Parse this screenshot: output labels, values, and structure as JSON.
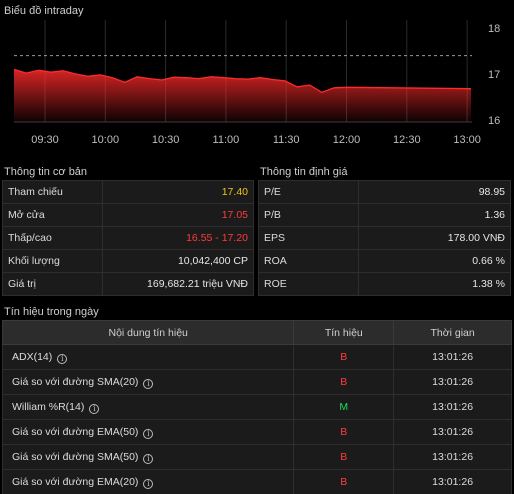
{
  "chart": {
    "title": "Biểu đồ intraday",
    "y_ticks": [
      "18",
      "17",
      "16"
    ],
    "x_ticks": [
      "09:30",
      "10:00",
      "10:30",
      "11:00",
      "11:30",
      "12:00",
      "12:30",
      "13:00"
    ]
  },
  "chart_data": {
    "type": "area",
    "x": [
      "09:15",
      "09:20",
      "09:25",
      "09:30",
      "09:35",
      "09:40",
      "09:45",
      "09:50",
      "09:55",
      "10:00",
      "10:05",
      "10:10",
      "10:15",
      "10:20",
      "10:25",
      "10:30",
      "10:35",
      "10:40",
      "10:45",
      "10:50",
      "10:55",
      "11:00",
      "11:05",
      "11:10",
      "11:15",
      "11:20",
      "11:25",
      "11:30",
      "13:00"
    ],
    "values": [
      17.1,
      17.02,
      17.08,
      17.04,
      17.07,
      17.0,
      16.95,
      16.98,
      16.92,
      16.82,
      16.94,
      16.9,
      16.87,
      16.93,
      16.92,
      16.9,
      16.94,
      16.92,
      16.9,
      16.89,
      16.92,
      16.88,
      16.85,
      16.72,
      16.76,
      16.6,
      16.7,
      16.71,
      16.68
    ],
    "reference": 17.4,
    "ylim": [
      16.0,
      18.0
    ],
    "colors": {
      "line": "#ff2a2a",
      "reference": "#9a9a9a"
    }
  },
  "basic_info": {
    "title": "Thông tin cơ bản",
    "rows": [
      {
        "label": "Tham chiếu",
        "value": "17.40"
      },
      {
        "label": "Mở cửa",
        "value": "17.05"
      },
      {
        "label": "Thấp/cao",
        "low": "16.55",
        "sep": " - ",
        "high": "17.20"
      },
      {
        "label": "Khối lượng",
        "value": "10,042,400 CP"
      },
      {
        "label": "Giá trị",
        "value": "169,682.21 triệu VNĐ"
      }
    ]
  },
  "valuation": {
    "title": "Thông tin định giá",
    "rows": [
      {
        "label": "P/E",
        "value": "98.95"
      },
      {
        "label": "P/B",
        "value": "1.36"
      },
      {
        "label": "EPS",
        "value": "178.00 VNĐ"
      },
      {
        "label": "ROA",
        "value": "0.66 %"
      },
      {
        "label": "ROE",
        "value": "1.38 %"
      }
    ]
  },
  "signals": {
    "title": "Tín hiệu trong ngày",
    "headers": [
      "Nội dung tín hiệu",
      "Tín hiệu",
      "Thời gian"
    ],
    "info_icon": "info-circle-icon",
    "rows": [
      {
        "name": "ADX(14)",
        "signal": "B",
        "time": "13:01:26"
      },
      {
        "name": "Giá so với đường SMA(20)",
        "signal": "B",
        "time": "13:01:26"
      },
      {
        "name": "William %R(14)",
        "signal": "M",
        "time": "13:01:26"
      },
      {
        "name": "Giá so với đường EMA(50)",
        "signal": "B",
        "time": "13:01:26"
      },
      {
        "name": "Giá so với đường SMA(50)",
        "signal": "B",
        "time": "13:01:26"
      },
      {
        "name": "Giá so với đường EMA(20)",
        "signal": "B",
        "time": "13:01:26"
      }
    ]
  },
  "colors": {
    "reference": "#f0c419",
    "down": "#ff3b3b",
    "up": "#1ed760"
  }
}
